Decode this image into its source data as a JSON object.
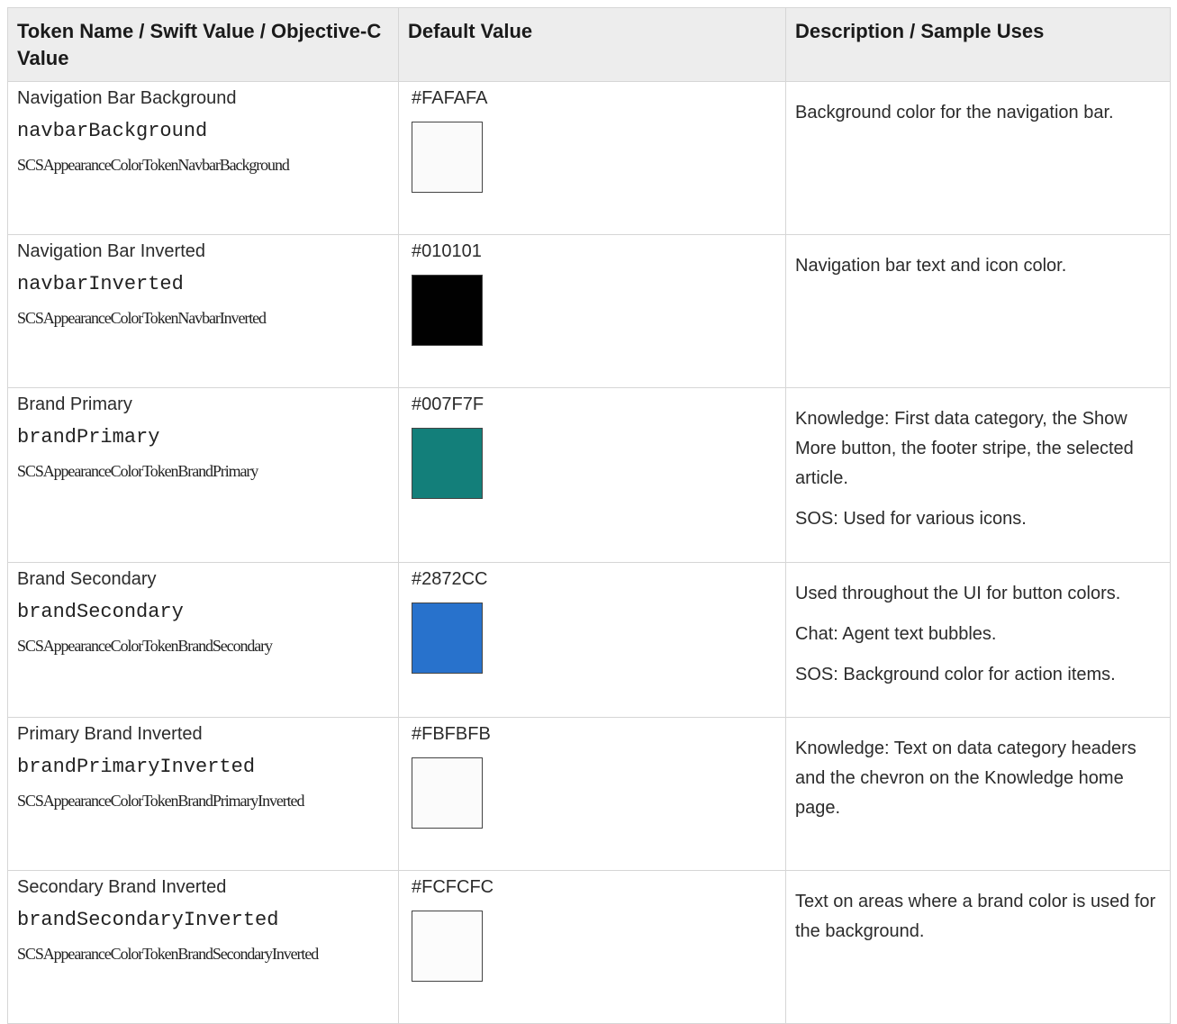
{
  "headers": {
    "col1": "Token Name / Swift Value / Objective-C Value",
    "col2": "Default Value",
    "col3": "Description / Sample Uses"
  },
  "rows": [
    {
      "name": "Navigation Bar Background",
      "swift": "navbarBackground",
      "objc": "SCSAppearanceColorTokenNavbarBackground",
      "hex": "#FAFAFA",
      "swatch_color": "#FAFAFA",
      "desc": [
        "Background color for the navigation bar."
      ]
    },
    {
      "name": "Navigation Bar Inverted",
      "swift": "navbarInverted",
      "objc": "SCSAppearanceColorTokenNavbarInverted",
      "hex": "#010101",
      "swatch_color": "#010101",
      "desc": [
        "Navigation bar text and icon color."
      ]
    },
    {
      "name": "Brand Primary",
      "swift": "brandPrimary",
      "objc": "SCSAppearanceColorTokenBrandPrimary",
      "hex": "#007F7F",
      "swatch_color": "#137F7A",
      "desc": [
        "Knowledge: First data category, the Show More button, the footer stripe, the selected article.",
        "SOS: Used for various icons."
      ]
    },
    {
      "name": "Brand Secondary",
      "swift": "brandSecondary",
      "objc": "SCSAppearanceColorTokenBrandSecondary",
      "hex": "#2872CC",
      "swatch_color": "#2872CC",
      "desc": [
        "Used throughout the UI for button colors.",
        "Chat: Agent text bubbles.",
        "SOS: Background color for action items."
      ]
    },
    {
      "name": "Primary Brand Inverted",
      "swift": "brandPrimaryInverted",
      "objc": "SCSAppearanceColorTokenBrandPrimaryInverted",
      "hex": "#FBFBFB",
      "swatch_color": "#FBFBFB",
      "desc": [
        "Knowledge: Text on data category headers and the chevron on the Knowledge home page."
      ]
    },
    {
      "name": "Secondary Brand Inverted",
      "swift": "brandSecondaryInverted",
      "objc": "SCSAppearanceColorTokenBrandSecondaryInverted",
      "hex": "#FCFCFC",
      "swatch_color": "#FCFCFC",
      "desc": [
        "Text on areas where a brand color is used for the background."
      ]
    }
  ]
}
